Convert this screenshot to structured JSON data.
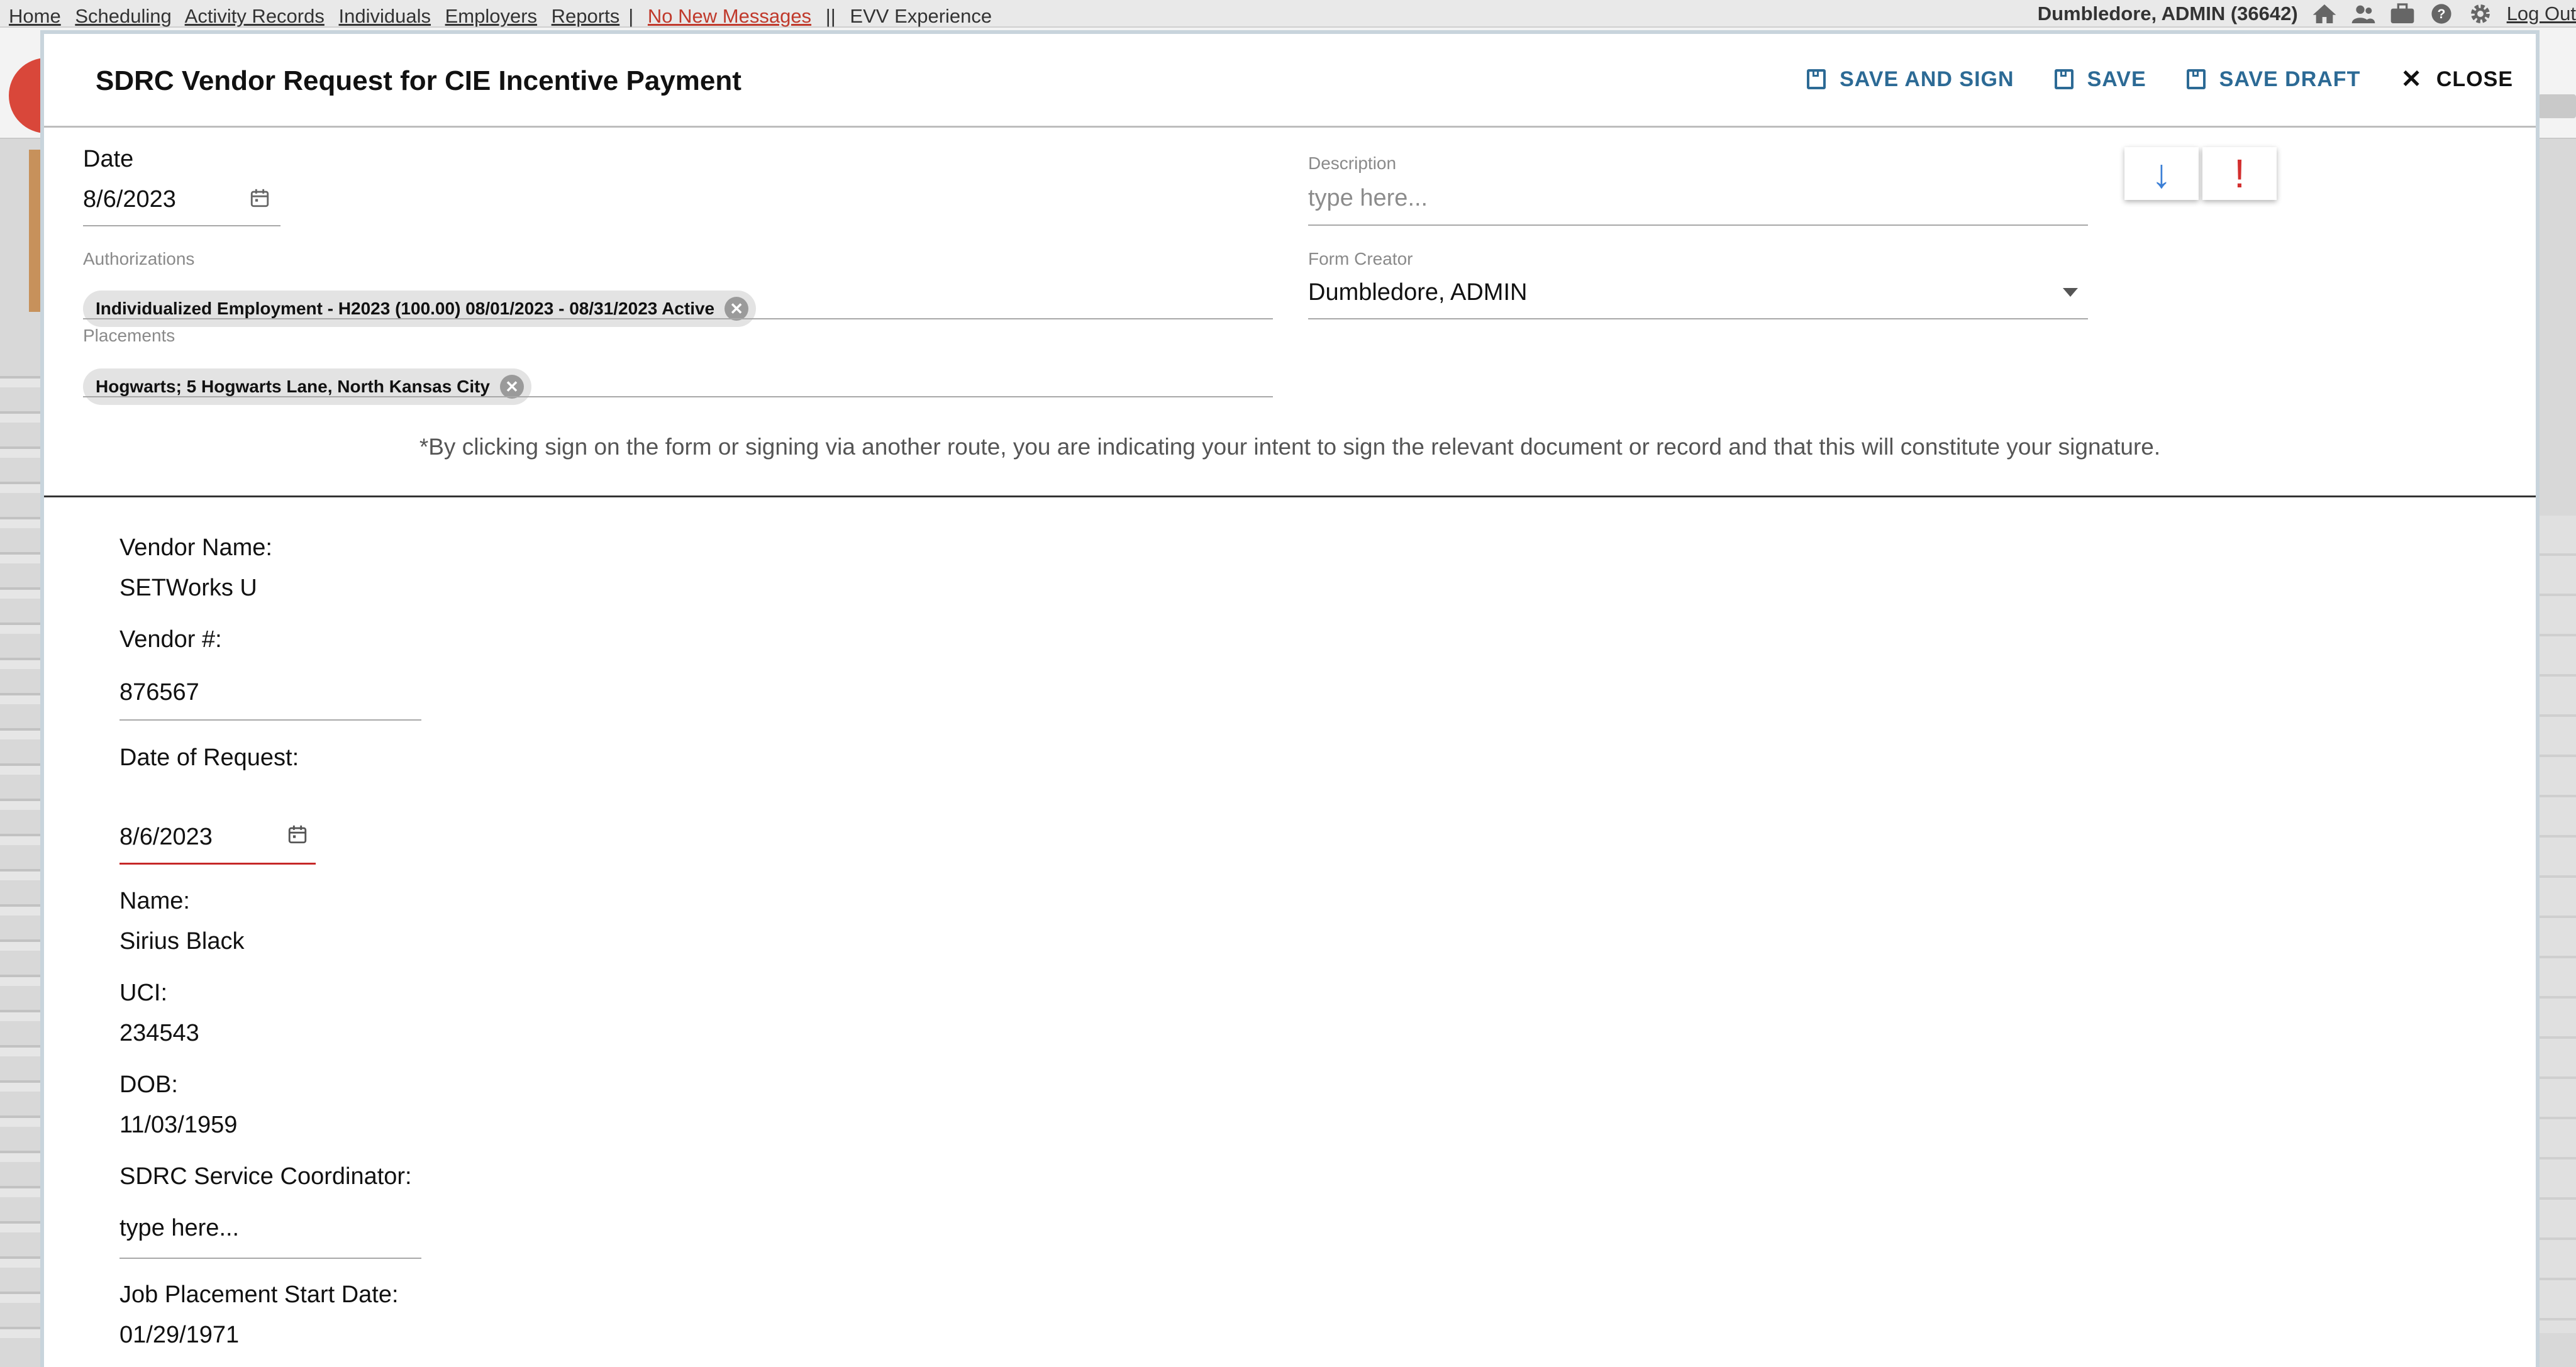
{
  "top_nav": {
    "links": [
      "Home",
      "Scheduling",
      "Activity Records",
      "Individuals",
      "Employers",
      "Reports"
    ],
    "messages": "No New Messages",
    "evv": "EVV Experience",
    "user": "Dumbledore, ADMIN (36642)",
    "icons": [
      "home-icon",
      "users-icon",
      "briefcase-icon",
      "help-icon",
      "gear-icon"
    ],
    "logout": "Log Out"
  },
  "modal": {
    "title": "SDRC Vendor Request for CIE Incentive Payment",
    "actions": {
      "save_and_sign": "SAVE AND SIGN",
      "save": "SAVE",
      "save_draft": "SAVE DRAFT",
      "close": "CLOSE"
    },
    "date": {
      "label": "Date",
      "value": "8/6/2023"
    },
    "description": {
      "label": "Description",
      "placeholder": "type here..."
    },
    "authorizations": {
      "label": "Authorizations",
      "chip": "Individualized Employment - H2023 (100.00) 08/01/2023 - 08/31/2023 Active"
    },
    "form_creator": {
      "label": "Form Creator",
      "value": "Dumbledore, ADMIN"
    },
    "placements": {
      "label": "Placements",
      "chip": "Hogwarts; 5 Hogwarts Lane, North Kansas City"
    },
    "flag_buttons": {
      "down": "↓",
      "alert": "!"
    },
    "disclaimer": "*By clicking sign on the form or signing via another route, you are indicating your intent to sign the relevant document or record and that this will constitute your signature.",
    "form": {
      "vendor_name_label": "Vendor Name:",
      "vendor_name": "SETWorks U",
      "vendor_num_label": "Vendor #:",
      "vendor_num": "876567",
      "date_of_request_label": "Date of Request:",
      "date_of_request": "8/6/2023",
      "name_label": "Name:",
      "name": "Sirius Black",
      "uci_label": "UCI:",
      "uci": "234543",
      "dob_label": "DOB:",
      "dob": "11/03/1959",
      "coordinator_label": "SDRC Service Coordinator:",
      "coordinator_placeholder": "type here...",
      "job_start_label": "Job Placement Start Date:",
      "job_start": "01/29/1971"
    }
  },
  "colors": {
    "accent": "#2c6a95",
    "alert": "#d32f2f",
    "down_arrow": "#3b7fd6",
    "error_underline": "#c62828"
  }
}
